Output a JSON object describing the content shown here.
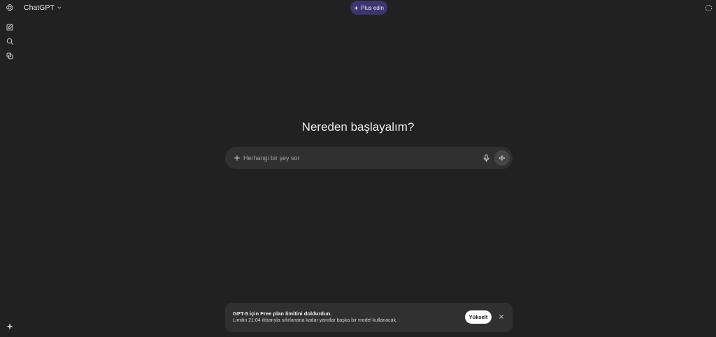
{
  "header": {
    "model_name": "ChatGPT",
    "upgrade_plus_label": "Plus edin"
  },
  "sidebar": {
    "items": [
      {
        "icon": "new-chat-icon"
      },
      {
        "icon": "search-icon"
      },
      {
        "icon": "library-icon"
      }
    ],
    "bottom_icon": "sparkle-icon"
  },
  "main": {
    "heading": "Nereden başlayalım?",
    "composer": {
      "placeholder": "Herhangi bir şey sor",
      "value": ""
    }
  },
  "limit_banner": {
    "title": "GPT-5 için Free plan limitini doldurdun.",
    "message": "Limitin 21:04 itibarıyla sıfırlanana kadar yanıtlar başka bir model kullanacak.",
    "upgrade_label": "Yükselt"
  },
  "colors": {
    "background": "#212121",
    "surface": "#303030",
    "plus_button": "#3b3570"
  }
}
